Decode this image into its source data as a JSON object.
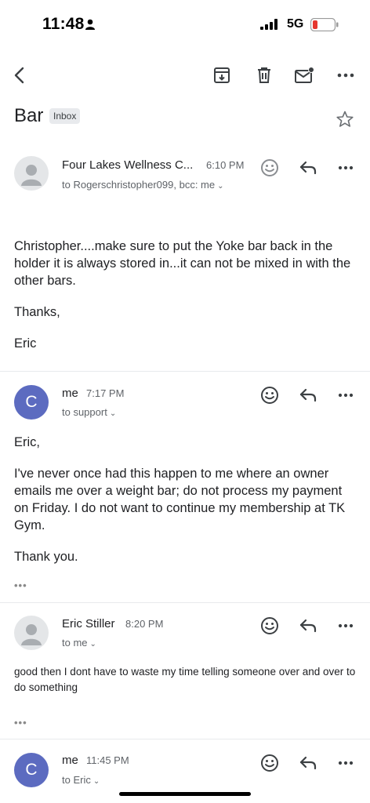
{
  "status_bar": {
    "time": "11:48",
    "network": "5G",
    "battery_icon": "battery-low-icon"
  },
  "toolbar": {
    "icons": [
      "back-icon",
      "archive-icon",
      "delete-icon",
      "mark-unread-icon",
      "more-icon"
    ]
  },
  "email": {
    "subject": "Bar",
    "label": "Inbox"
  },
  "messages": [
    {
      "sender": "Four Lakes Wellness C...",
      "time": "6:10 PM",
      "recipients": "to Rogerschristopher099, bcc: me",
      "body": [
        "Christopher....make sure to put the Yoke bar back in the holder it is always stored in...it can not be mixed in with the other bars.",
        "Thanks,",
        "Eric"
      ]
    },
    {
      "sender": "me",
      "time": "7:17 PM",
      "avatar_initial": "C",
      "recipients": "to support",
      "body": [
        "Eric,",
        "I've never once had this happen to me where an owner emails me over a weight bar; do not process my payment on Friday. I do not want to continue my membership at TK Gym.",
        "Thank you."
      ]
    },
    {
      "sender": "Eric Stiller",
      "time": "8:20 PM",
      "recipients": "to me",
      "body": [
        "good then I dont have to waste my time telling someone over and over to do something"
      ]
    },
    {
      "sender": "me",
      "time": "11:45 PM",
      "avatar_initial": "C",
      "recipients": "to Eric"
    }
  ],
  "ui": {
    "ellipsis": "•••",
    "chevron": "⌄"
  },
  "colors": {
    "avatar_me": "#5c6bc0",
    "chip_bg": "#e8eaed"
  }
}
